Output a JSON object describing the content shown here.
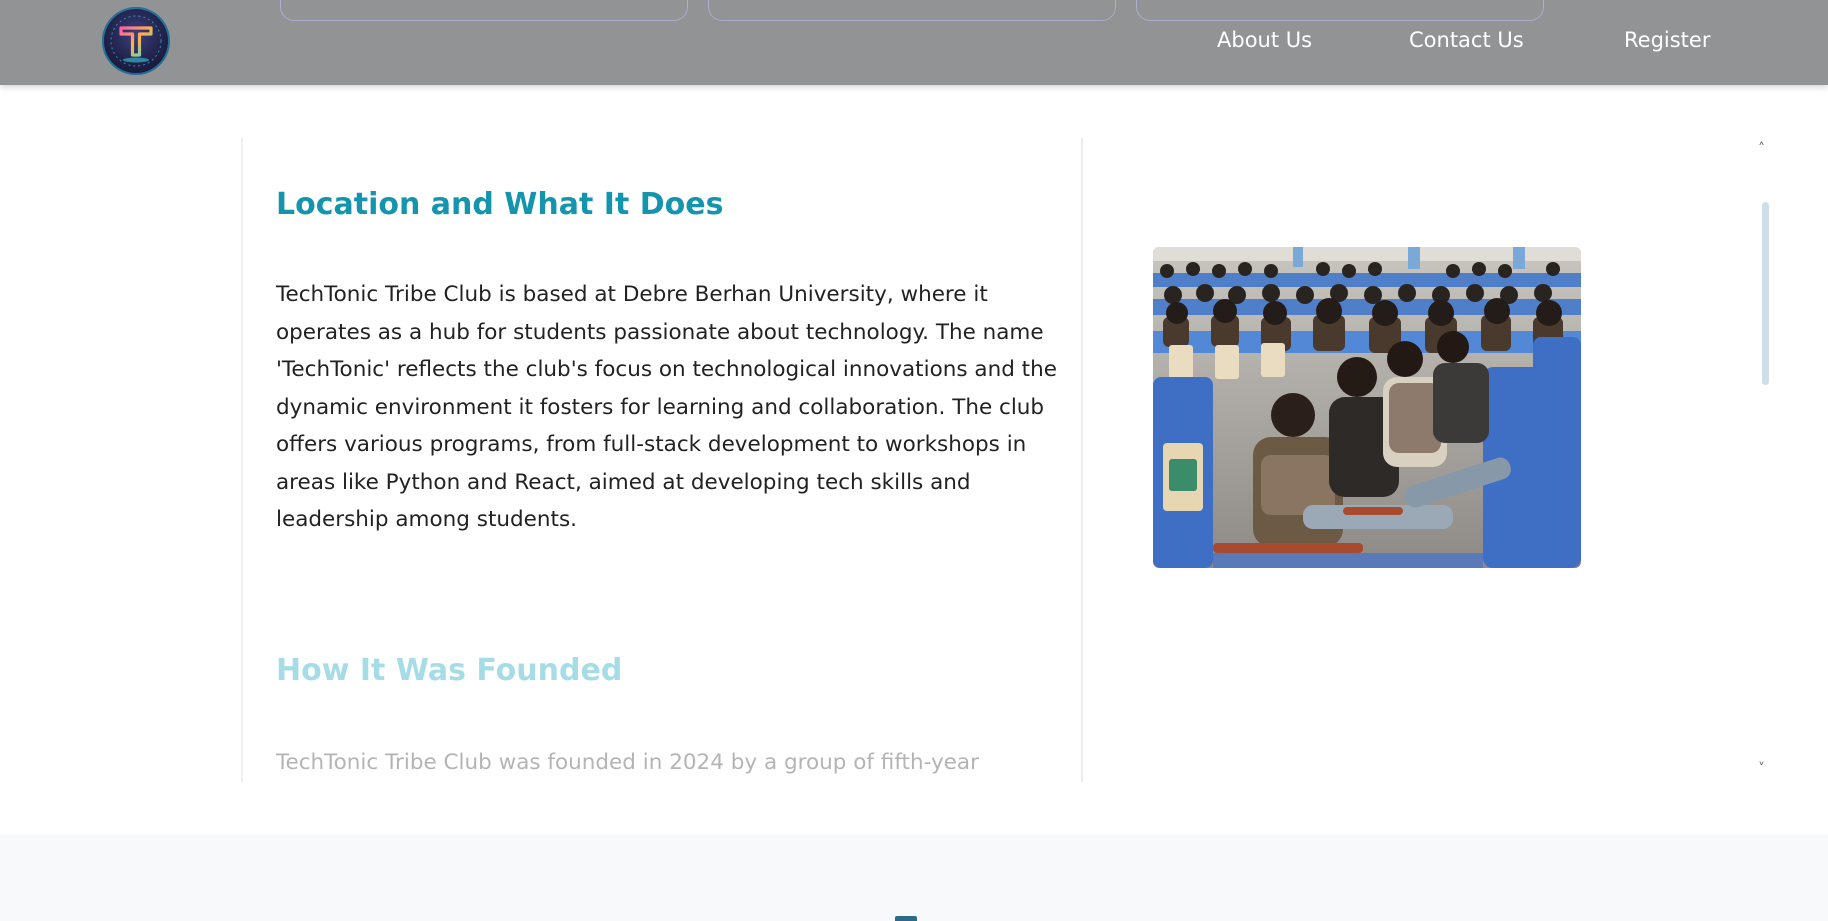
{
  "nav": {
    "logo_icon": "techtonic-t-logo",
    "links": {
      "about": "About Us",
      "contact": "Contact Us",
      "register": "Register"
    },
    "bg_color": "#929395"
  },
  "content": {
    "section1": {
      "title": "Location and What It Does",
      "text": "TechTonic Tribe Club is based at Debre Berhan University, where it operates as a hub for students passionate about technology. The name 'TechTonic' reflects the club's focus on technological innovations and the dynamic environment it fosters for learning and collaboration. The club offers various programs, from full-stack development to workshops in areas like Python and React, aimed at developing tech skills and leadership among students."
    },
    "section2": {
      "title": "How It Was Founded",
      "text": "TechTonic Tribe Club was founded in 2024 by a group of fifth-year"
    },
    "accent_color": "#1495ad"
  },
  "photo": {
    "subject": "students-seated-in-auditorium-photo"
  },
  "scroll": {
    "up_icon": "chevron-up-icon",
    "down_icon": "chevron-down-icon",
    "up_glyph": "˄",
    "down_glyph": "˅"
  }
}
